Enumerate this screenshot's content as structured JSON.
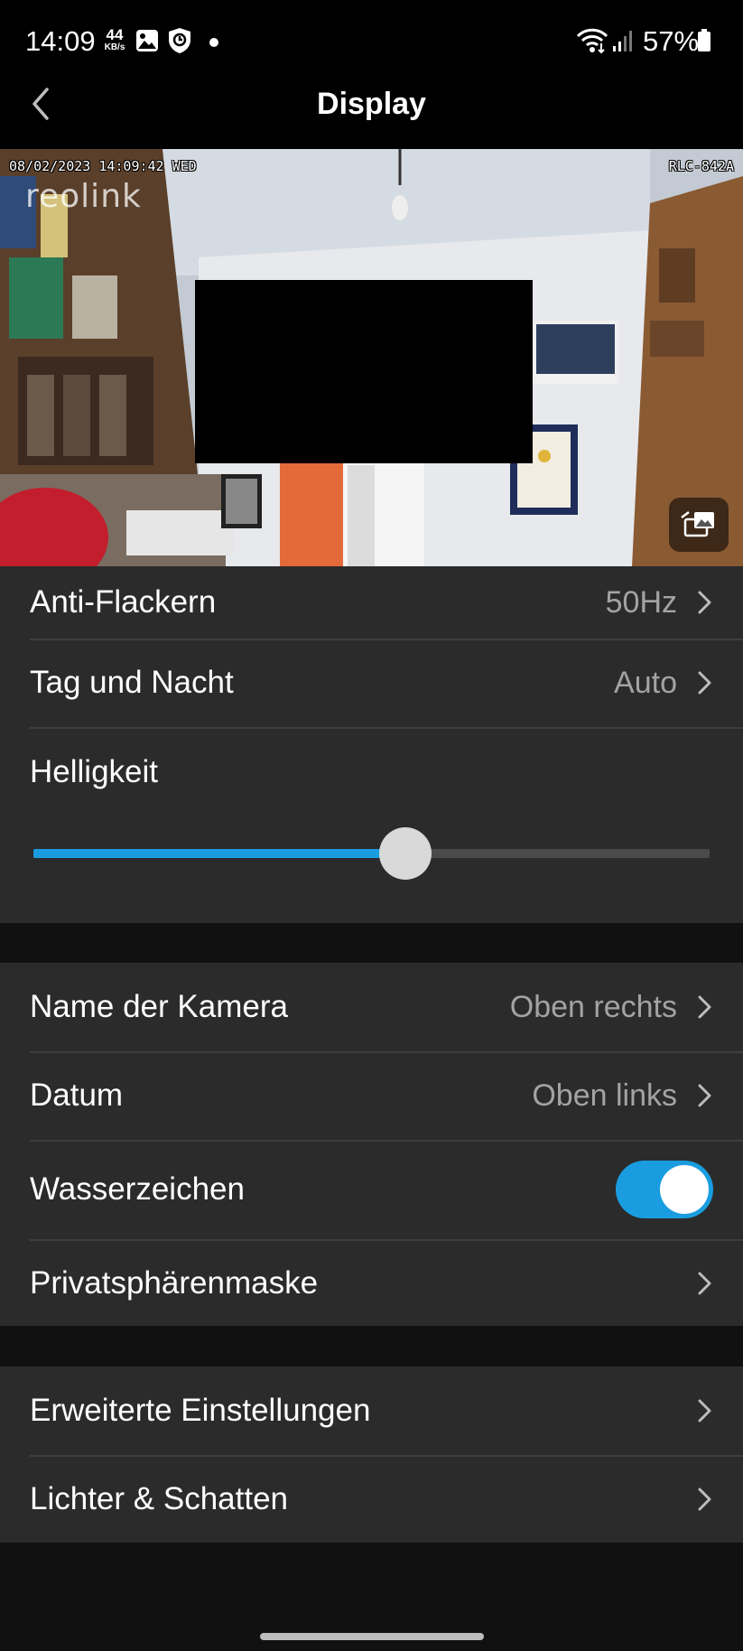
{
  "status_bar": {
    "time": "14:09",
    "net_speed": "44",
    "net_speed_unit": "KB/s",
    "battery": "57%"
  },
  "header": {
    "title": "Display",
    "back_icon": "back-chevron-icon"
  },
  "preview": {
    "osd_datetime": "08/02/2023 14:09:42 WED",
    "osd_camera_name": "RLC-842A",
    "watermark": "reolink",
    "snapshot_icon": "snapshot-switch-icon"
  },
  "settings": {
    "anti_flicker": {
      "label": "Anti-Flackern",
      "value": "50Hz"
    },
    "day_night": {
      "label": "Tag und Nacht",
      "value": "Auto"
    },
    "brightness": {
      "label": "Helligkeit",
      "level_percent": 55
    },
    "camera_name": {
      "label": "Name der Kamera",
      "value": "Oben rechts"
    },
    "date": {
      "label": "Datum",
      "value": "Oben links"
    },
    "watermark": {
      "label": "Wasserzeichen",
      "enabled": true
    },
    "privacy_mask": {
      "label": "Privatsphärenmaske"
    },
    "advanced": {
      "label": "Erweiterte Einstellungen"
    },
    "lights_shadows": {
      "label": "Lichter & Schatten"
    }
  },
  "colors": {
    "accent": "#1a9de0",
    "row_background": "#2b2b2b",
    "page_background": "#111111",
    "secondary_text": "#a3a3a3"
  }
}
